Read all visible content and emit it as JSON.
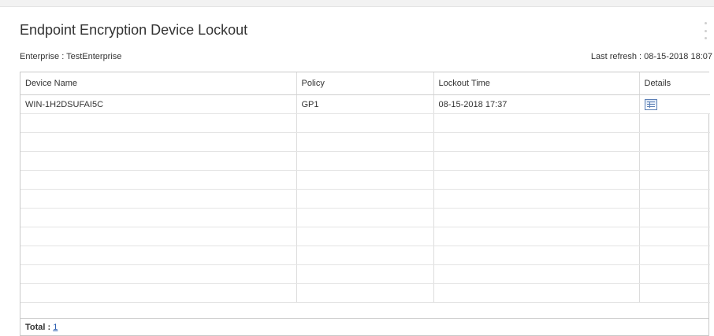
{
  "widget": {
    "title": "Endpoint Encryption Device Lockout",
    "enterprise": "Enterprise : TestEnterprise",
    "last_refresh": "Last refresh : 08-15-2018 18:07"
  },
  "table": {
    "columns": [
      "Device Name",
      "Policy",
      "Lockout Time",
      "Details"
    ],
    "rows": [
      {
        "device_name": "WIN-1H2DSUFAI5C",
        "policy": "GP1",
        "lockout_time": "08-15-2018 17:37",
        "details_icon": "details-grid-icon"
      }
    ]
  },
  "footer": {
    "total_label": "Total : ",
    "total_value": "1"
  },
  "colors": {
    "border": "#c9c9c9",
    "link": "#2a5db0",
    "text": "#333333"
  }
}
